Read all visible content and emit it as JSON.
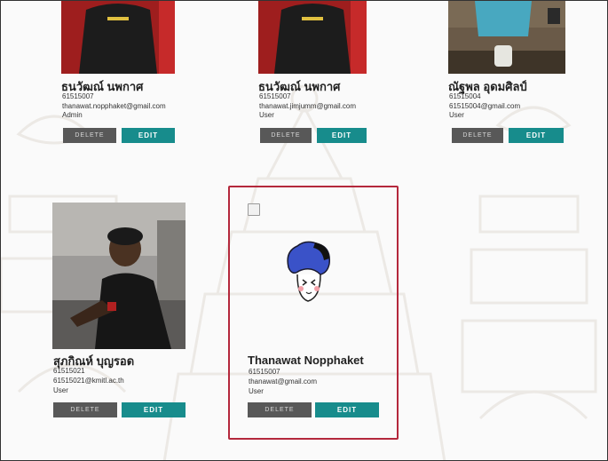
{
  "cards": [
    {
      "name": "ธนวัฒณ์ นพกาศ",
      "id": "61515007",
      "email": "thanawat.nopphaket@gmail.com",
      "role": "Admin",
      "delete_label": "DELETE",
      "edit_label": "EDIT"
    },
    {
      "name": "ธนวัฒณ์ นพกาศ",
      "id": "61515007",
      "email": "thanawat.jimjumm@gmail.com",
      "role": "User",
      "delete_label": "DELETE",
      "edit_label": "EDIT"
    },
    {
      "name": "ณัฐพล อุดมศิลป์",
      "id": "61515004",
      "email": "61515004@gmail.com",
      "role": "User",
      "delete_label": "DELETE",
      "edit_label": "EDIT"
    },
    {
      "name": "สุภกิณห์ บุญรอด",
      "id": "61515021",
      "email": "61515021@kmitl.ac.th",
      "role": "User",
      "delete_label": "DELETE",
      "edit_label": "EDIT"
    },
    {
      "name": "Thanawat Nopphaket",
      "id": "61515007",
      "email": "thanawat@gmail.com",
      "role": "User",
      "delete_label": "DELETE",
      "edit_label": "EDIT"
    }
  ],
  "colors": {
    "accent": "#178c8c",
    "delete": "#585858",
    "selected_border": "#b4283c"
  }
}
